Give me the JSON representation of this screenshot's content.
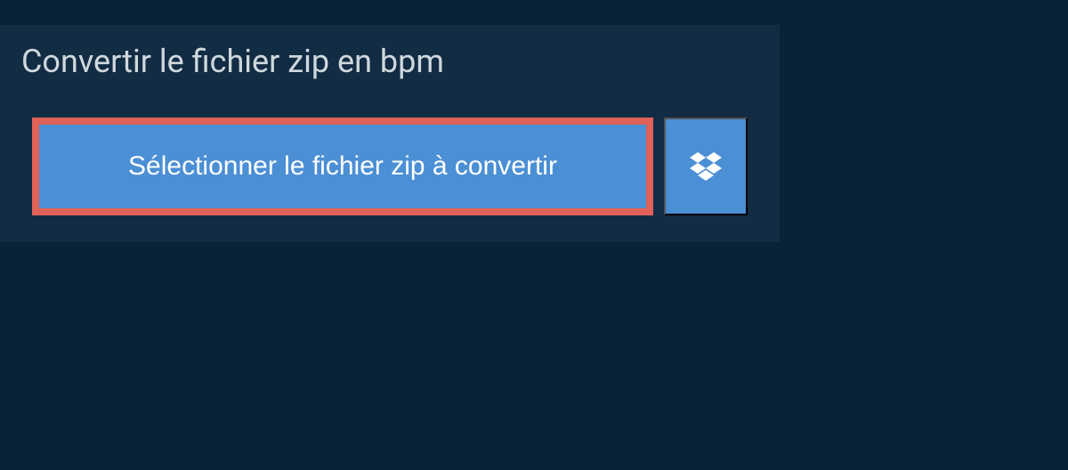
{
  "title": "Convertir le fichier zip en bpm",
  "select_button_label": "Sélectionner le fichier zip à convertir",
  "colors": {
    "page_bg": "#0a2238",
    "panel_bg": "#122c44",
    "button_bg": "#4b8fd5",
    "highlight_border": "#df6158",
    "title_text": "#cfd8dd",
    "button_text": "#ffffff"
  }
}
